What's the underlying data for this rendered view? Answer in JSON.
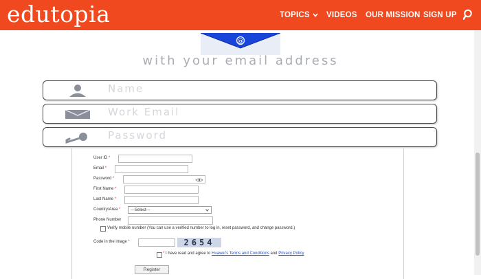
{
  "header": {
    "logo": "edutopia",
    "nav": {
      "topics": "TOPICS",
      "videos": "VIDEOS",
      "mission": "OUR MISSION",
      "signup": "SIGN UP"
    }
  },
  "banner": {
    "tagline": "with your email address"
  },
  "signup_fields": {
    "name_placeholder": "Name",
    "email_placeholder": "Work Email",
    "password_placeholder": "Password"
  },
  "register_form": {
    "user_id_label": "User ID",
    "email_label": "Email",
    "password_label": "Password",
    "first_name_label": "First Name",
    "last_name_label": "Last Name",
    "country_label": "Country/Area",
    "country_selected": "---Select---",
    "phone_label": "Phone Number",
    "verify_mobile_text": "Verify mobile number (You can use a verified number to log in, reset password, and change password.)",
    "captcha_label": "Code in the image",
    "captcha_value": "2654",
    "agree_prefix": "I have read and agree to",
    "terms_link": "Huawei's Terms and Conditions",
    "agree_and": "and",
    "privacy_link": "Privacy Policy",
    "register_button": "Register",
    "required_mark": "*"
  },
  "colors": {
    "brand": "#f0491f",
    "envelope_blue": "#1a45d9",
    "link": "#1a4fd6"
  },
  "icons": [
    "chevron-down-icon",
    "search-icon",
    "envelope-at-icon",
    "user-icon",
    "mail-icon",
    "key-icon",
    "eye-icon"
  ]
}
